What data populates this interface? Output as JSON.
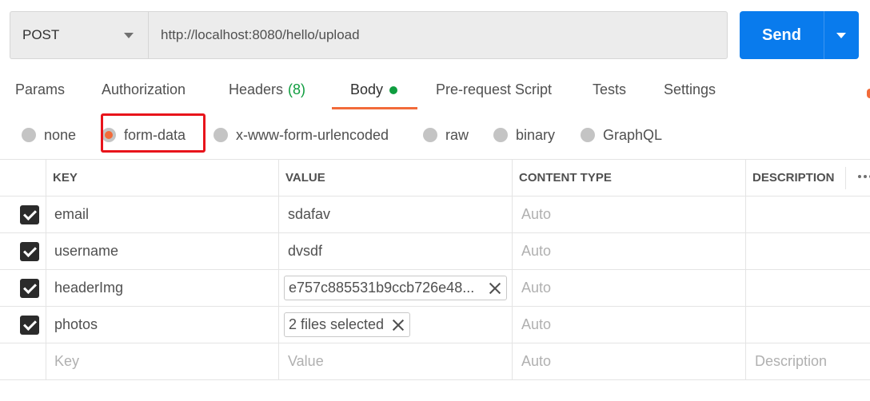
{
  "request": {
    "method": "POST",
    "url": "http://localhost:8080/hello/upload",
    "send_label": "Send"
  },
  "tabs": [
    {
      "label": "Params"
    },
    {
      "label": "Authorization"
    },
    {
      "label": "Headers",
      "count": "(8)"
    },
    {
      "label": "Body",
      "active": true
    },
    {
      "label": "Pre-request Script"
    },
    {
      "label": "Tests"
    },
    {
      "label": "Settings"
    }
  ],
  "body_types": [
    {
      "label": "none"
    },
    {
      "label": "form-data",
      "selected": true
    },
    {
      "label": "x-www-form-urlencoded"
    },
    {
      "label": "raw"
    },
    {
      "label": "binary"
    },
    {
      "label": "GraphQL"
    }
  ],
  "table": {
    "headers": {
      "key": "KEY",
      "value": "VALUE",
      "content_type": "CONTENT TYPE",
      "description": "DESCRIPTION"
    },
    "rows": [
      {
        "key": "email",
        "value": "sdafav",
        "content_type": "Auto",
        "checked": true
      },
      {
        "key": "username",
        "value": "dvsdf",
        "content_type": "Auto",
        "checked": true
      },
      {
        "key": "headerImg",
        "value": "e757c885531b9ccb726e48...",
        "content_type": "Auto",
        "checked": true,
        "is_file": true
      },
      {
        "key": "photos",
        "value": "2 files selected",
        "content_type": "Auto",
        "checked": true,
        "is_file": true
      }
    ],
    "placeholders": {
      "key": "Key",
      "value": "Value",
      "content_type": "Auto",
      "description": "Description"
    }
  },
  "colors": {
    "send_blue": "#097bed",
    "accent_orange": "#f26b3a",
    "indicator_green": "#0f9d3f",
    "highlight_red": "#e8141b"
  }
}
